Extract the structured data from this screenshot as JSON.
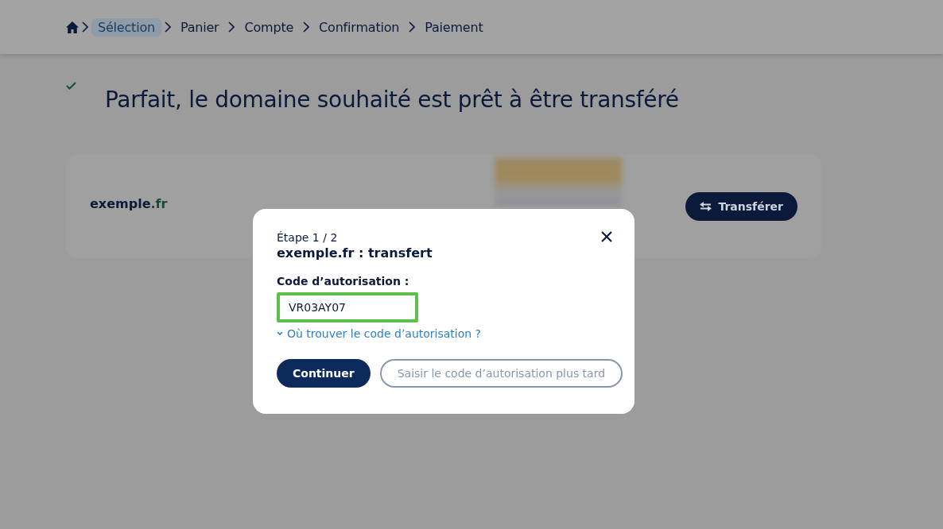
{
  "breadcrumb": [
    {
      "label": "Sélection",
      "selected": true
    },
    {
      "label": "Panier",
      "selected": false
    },
    {
      "label": "Compte",
      "selected": false
    },
    {
      "label": "Confirmation",
      "selected": false
    },
    {
      "label": "Paiement",
      "selected": false
    }
  ],
  "heading": "Parfait, le domaine souhaité est prêt à être transféré",
  "domain_card": {
    "name": "exemple",
    "tld": ".fr",
    "button": "Transférer"
  },
  "dialog": {
    "step": "Étape 1 / 2",
    "title": "exemple.fr : transfert",
    "field": {
      "label": "Code d’autorisation :",
      "value": "VR03AY07",
      "focused": true
    },
    "help_link": "Où trouver le code d’autorisation ?",
    "buttons": [
      {
        "label": "Continuer",
        "kind": "primary"
      },
      {
        "label": "Saisir le code d’autorisation plus tard",
        "kind": "secondary"
      }
    ]
  }
}
